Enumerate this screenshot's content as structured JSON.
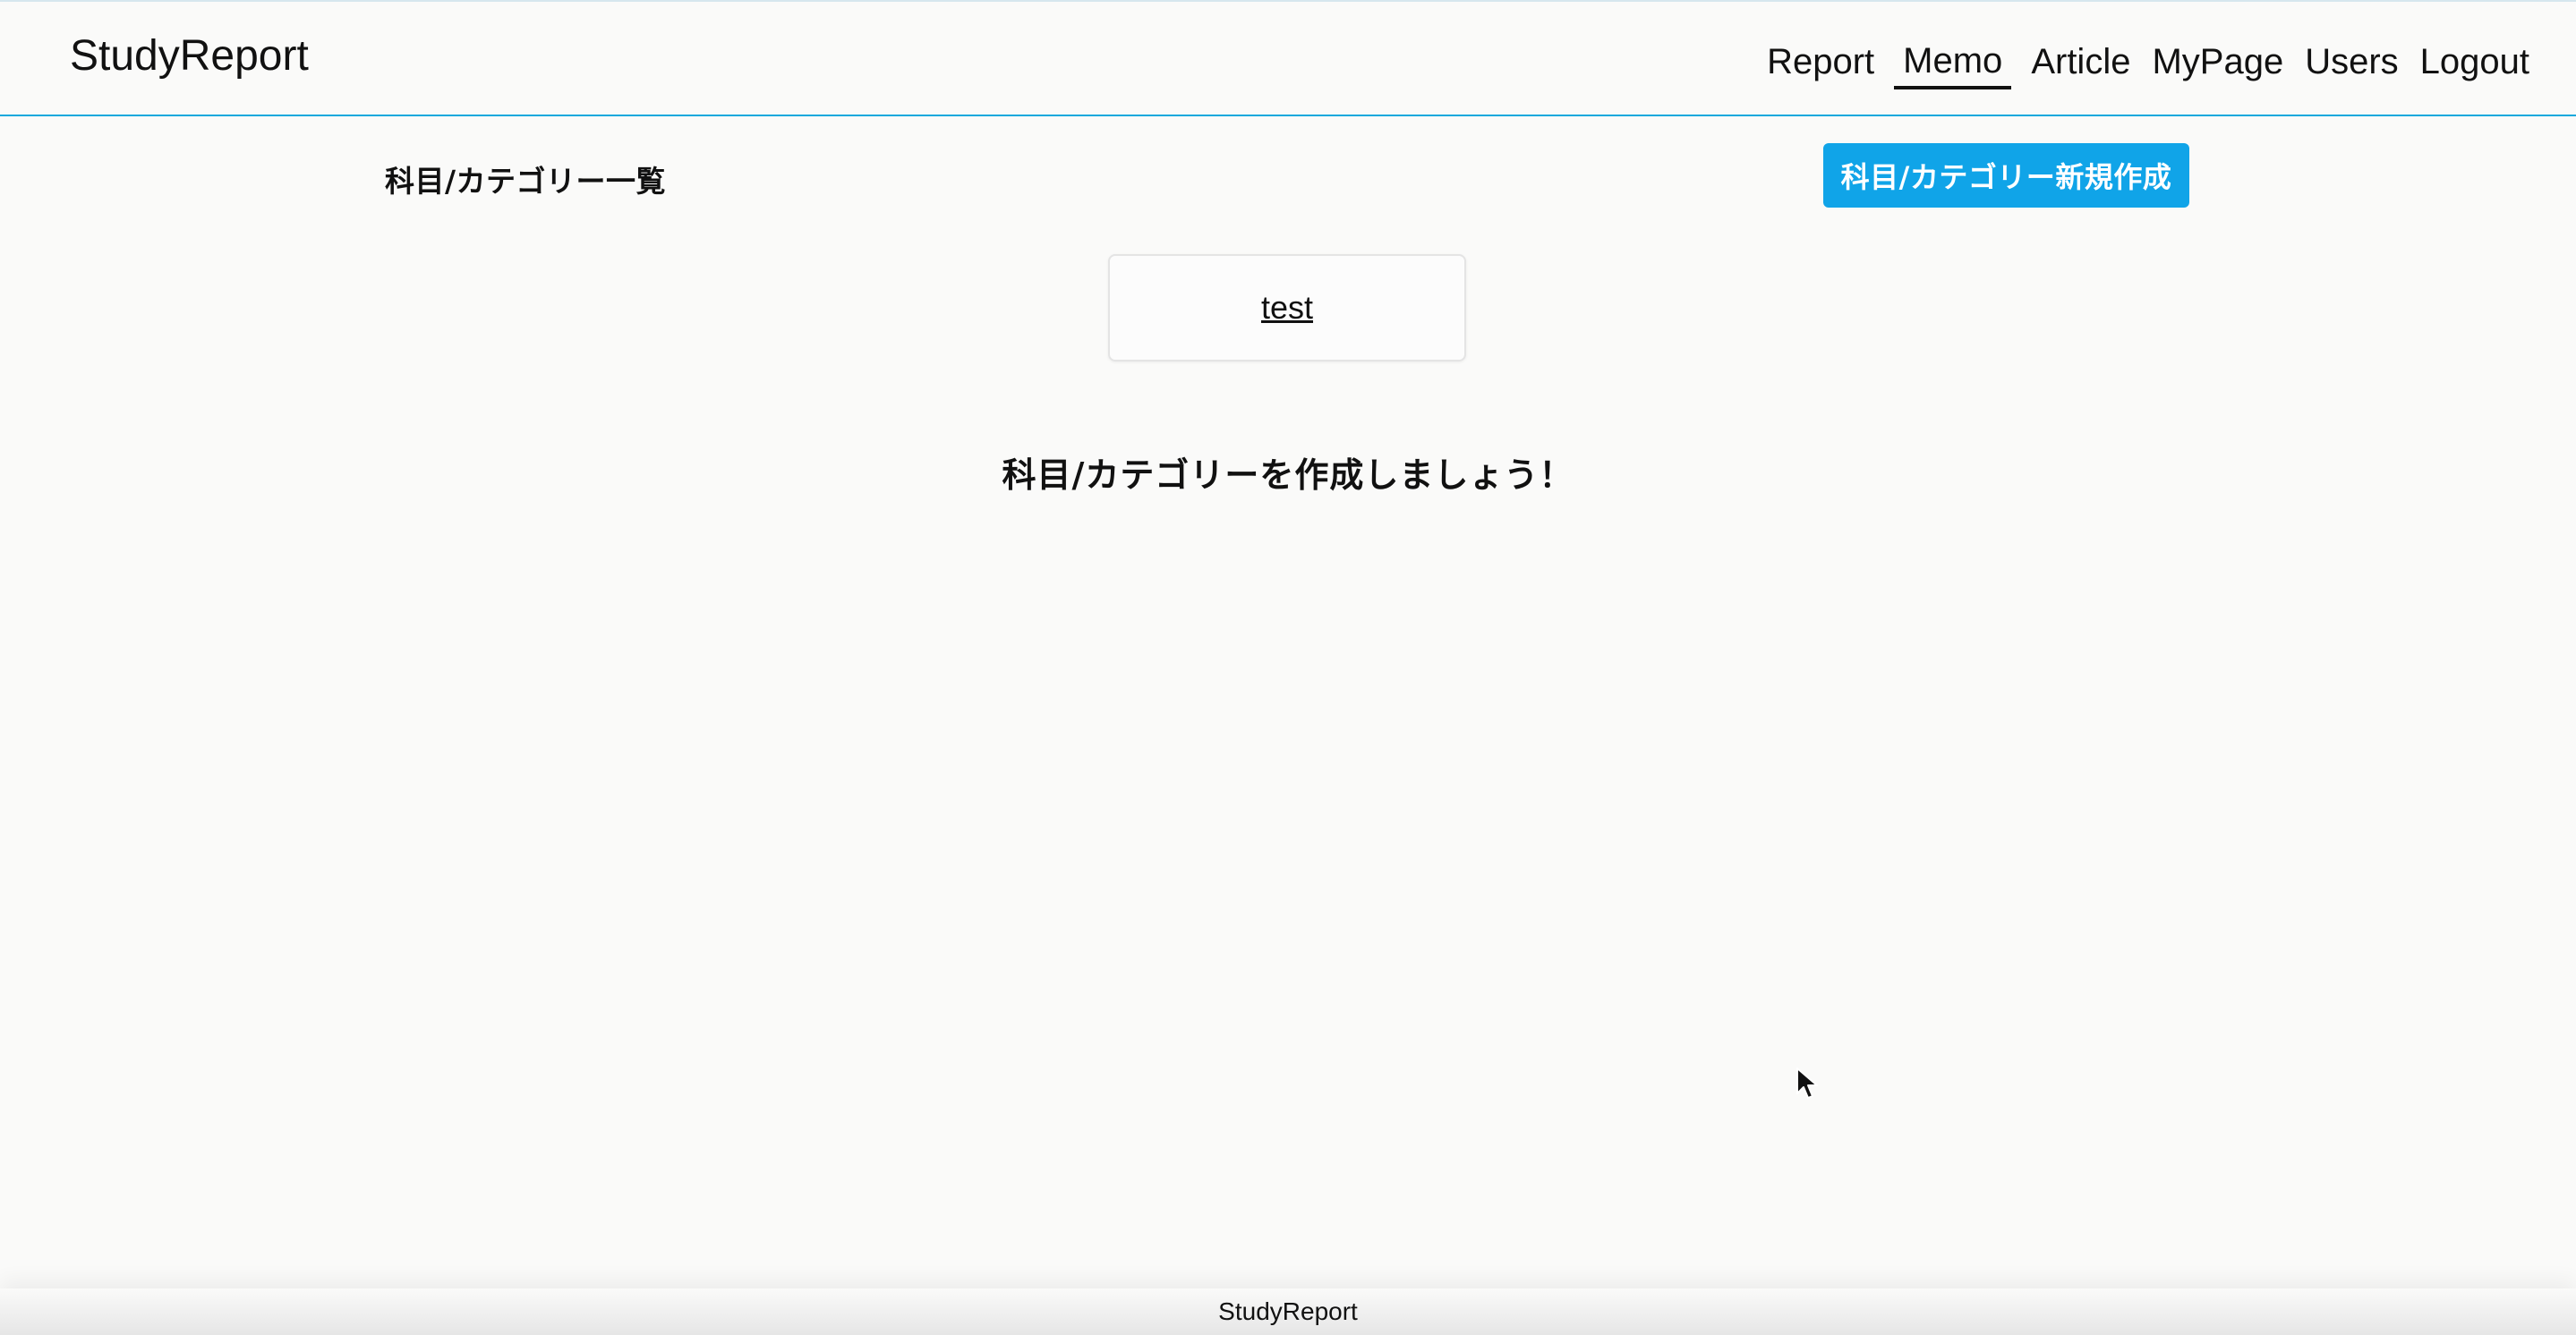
{
  "header": {
    "brand": "StudyReport",
    "nav": [
      {
        "label": "Report",
        "active": false
      },
      {
        "label": "Memo",
        "active": true
      },
      {
        "label": "Article",
        "active": false
      },
      {
        "label": "MyPage",
        "active": false
      },
      {
        "label": "Users",
        "active": false
      },
      {
        "label": "Logout",
        "active": false
      }
    ]
  },
  "main": {
    "section_title": "科目/カテゴリー一覧",
    "new_button_label": "科目/カテゴリー新規作成",
    "categories": [
      {
        "label": "test"
      }
    ],
    "empty_message": "科目/カテゴリーを作成しましょう！"
  },
  "footer": {
    "text": "StudyReport"
  },
  "colors": {
    "accent": "#10a4e8",
    "header_border": "#12a8dd",
    "background": "#fafaf9"
  }
}
